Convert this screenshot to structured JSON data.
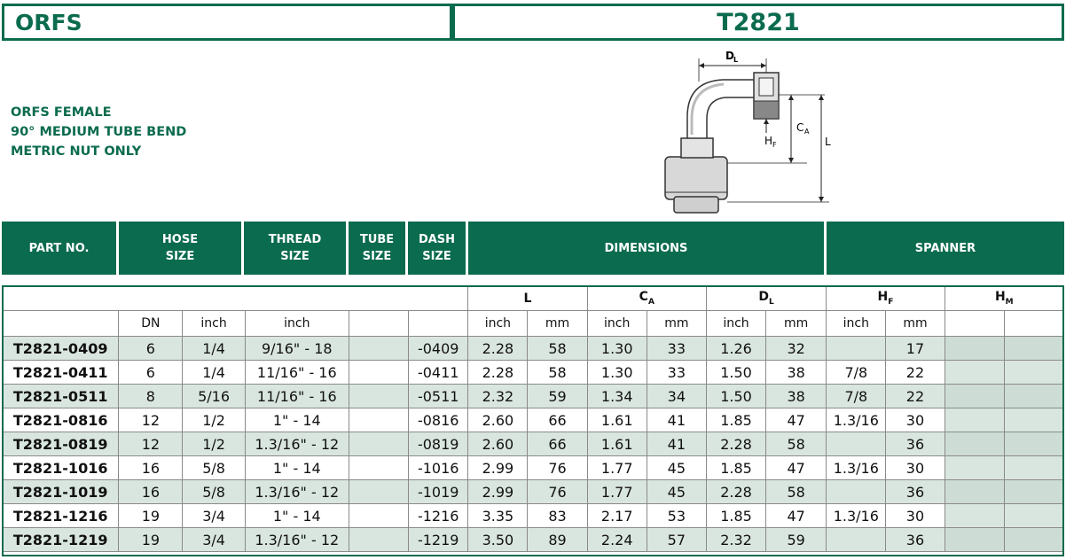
{
  "header": {
    "left_title": "ORFS",
    "right_title": "T2821"
  },
  "description": [
    "ORFS FEMALE",
    "90° MEDIUM TUBE BEND",
    "METRIC  NUT ONLY"
  ],
  "diagram": {
    "labels": {
      "dl": "D",
      "dl_sub": "L",
      "ca": "C",
      "ca_sub": "A",
      "hf": "H",
      "hf_sub": "F",
      "l": "L"
    }
  },
  "columns": {
    "part_no": "PART NO.",
    "hose_size": [
      "HOSE",
      "SIZE"
    ],
    "thread_size": [
      "THREAD",
      "SIZE"
    ],
    "tube_size": [
      "TUBE",
      "SIZE"
    ],
    "dash_size": [
      "DASH",
      "SIZE"
    ],
    "dimensions": "DIMENSIONS",
    "spanner": "SPANNER"
  },
  "subheaders": {
    "l": "L",
    "ca": "C",
    "ca_sub": "A",
    "dl": "D",
    "dl_sub": "L",
    "hf": "H",
    "hf_sub": "F",
    "hm": "H",
    "hm_sub": "M"
  },
  "units": [
    "",
    "DN",
    "inch",
    "inch",
    "",
    "",
    "inch",
    "mm",
    "inch",
    "mm",
    "inch",
    "mm",
    "inch",
    "mm",
    "",
    ""
  ],
  "rows": [
    [
      "T2821-0409",
      "6",
      "1/4",
      "9/16\" - 18",
      "",
      "-0409",
      "2.28",
      "58",
      "1.30",
      "33",
      "1.26",
      "32",
      "",
      "17",
      "",
      ""
    ],
    [
      "T2821-0411",
      "6",
      "1/4",
      "11/16\" - 16",
      "",
      "-0411",
      "2.28",
      "58",
      "1.30",
      "33",
      "1.50",
      "38",
      "7/8",
      "22",
      "",
      ""
    ],
    [
      "T2821-0511",
      "8",
      "5/16",
      "11/16\" - 16",
      "",
      "-0511",
      "2.32",
      "59",
      "1.34",
      "34",
      "1.50",
      "38",
      "7/8",
      "22",
      "",
      ""
    ],
    [
      "T2821-0816",
      "12",
      "1/2",
      "1\" - 14",
      "",
      "-0816",
      "2.60",
      "66",
      "1.61",
      "41",
      "1.85",
      "47",
      "1.3/16",
      "30",
      "",
      ""
    ],
    [
      "T2821-0819",
      "12",
      "1/2",
      "1.3/16\" - 12",
      "",
      "-0819",
      "2.60",
      "66",
      "1.61",
      "41",
      "2.28",
      "58",
      "",
      "36",
      "",
      ""
    ],
    [
      "T2821-1016",
      "16",
      "5/8",
      "1\" - 14",
      "",
      "-1016",
      "2.99",
      "76",
      "1.77",
      "45",
      "1.85",
      "47",
      "1.3/16",
      "30",
      "",
      ""
    ],
    [
      "T2821-1019",
      "16",
      "5/8",
      "1.3/16\" - 12",
      "",
      "-1019",
      "2.99",
      "76",
      "1.77",
      "45",
      "2.28",
      "58",
      "",
      "36",
      "",
      ""
    ],
    [
      "T2821-1216",
      "19",
      "3/4",
      "1\" - 14",
      "",
      "-1216",
      "3.35",
      "83",
      "2.17",
      "53",
      "1.85",
      "47",
      "1.3/16",
      "30",
      "",
      ""
    ],
    [
      "T2821-1219",
      "19",
      "3/4",
      "1.3/16\" - 12",
      "",
      "-1219",
      "3.50",
      "89",
      "2.24",
      "57",
      "2.32",
      "59",
      "",
      "36",
      "",
      ""
    ]
  ]
}
